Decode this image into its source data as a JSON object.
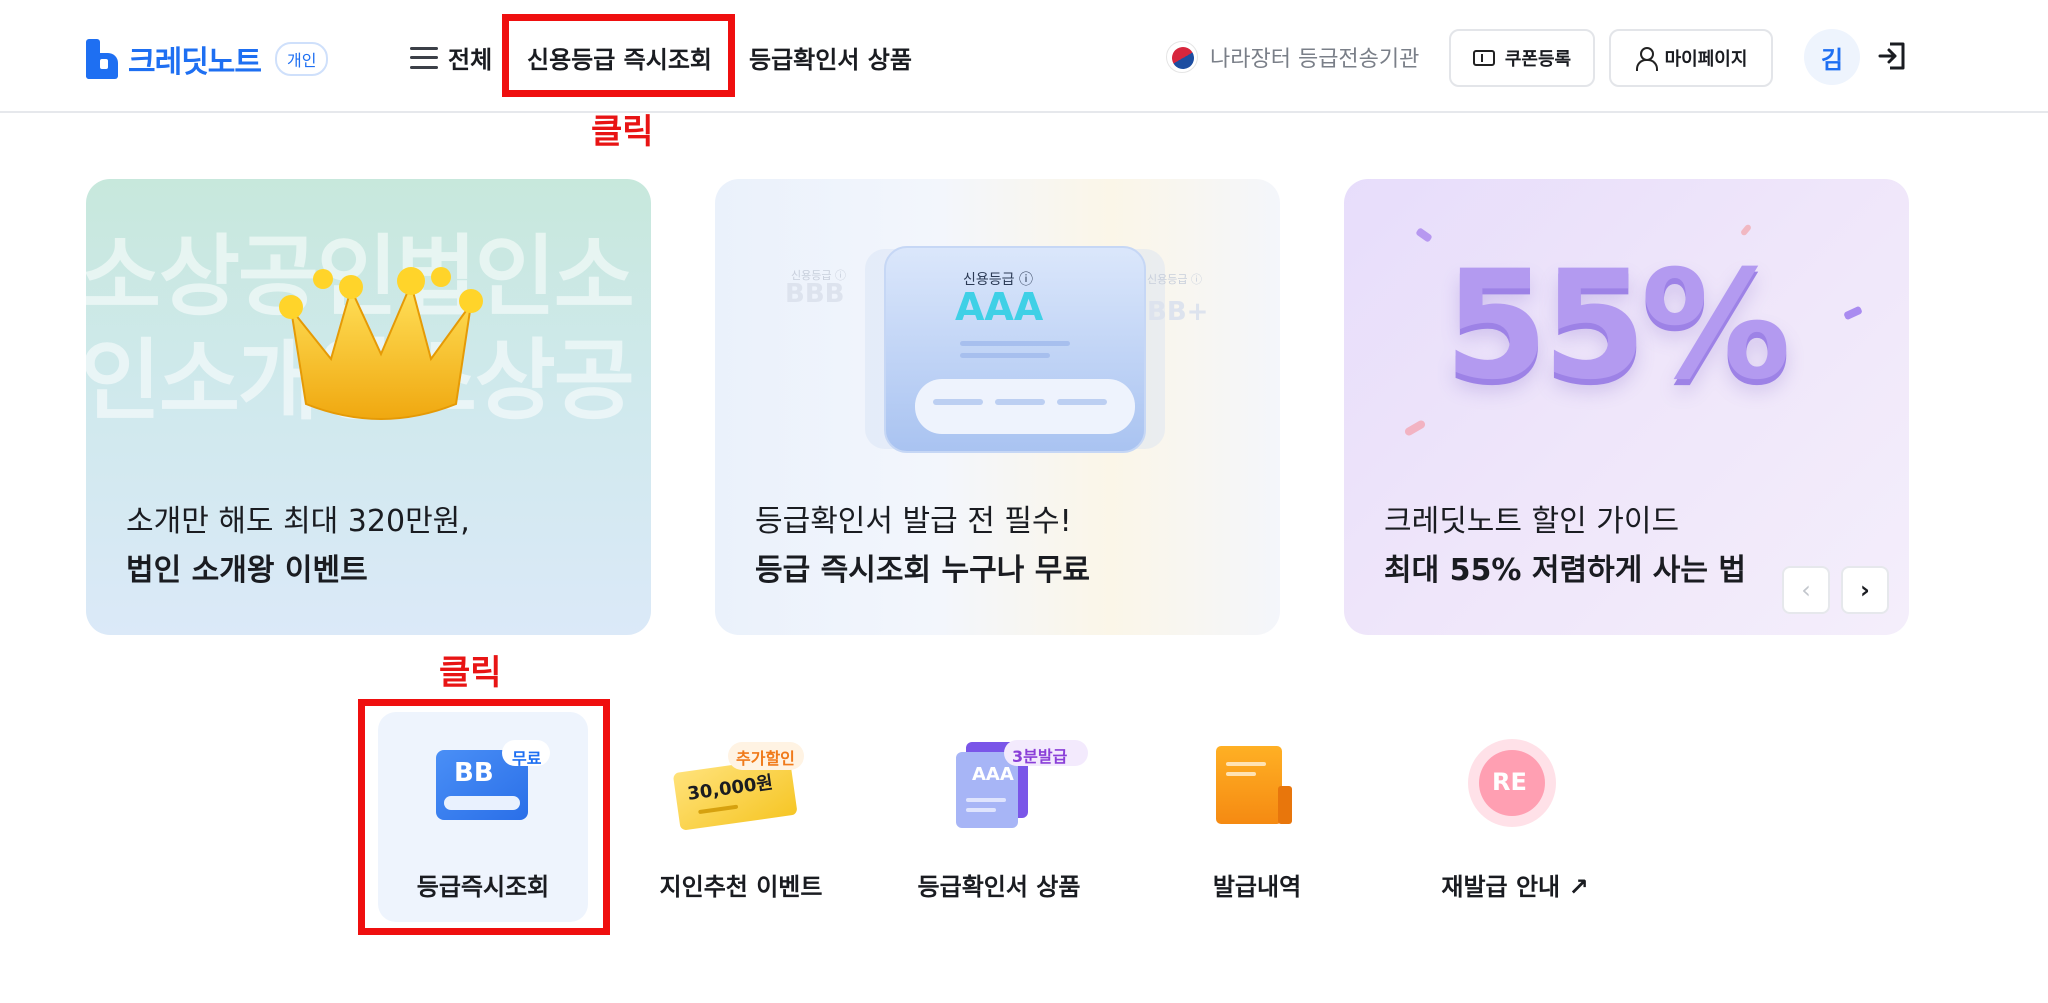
{
  "header": {
    "logo_text": "크레딧노트",
    "logo_badge": "개인",
    "nav_all": "전체",
    "nav_realtime": "신용등급 즉시조회",
    "nav_products": "등급확인서 상품",
    "agency": "나라장터 등급전송기관",
    "coupon": "쿠폰등록",
    "mypage": "마이페이지",
    "avatar": "김"
  },
  "annotations": {
    "click_top": "클릭",
    "click_bottom": "클릭"
  },
  "banners": [
    {
      "line1": "소개만 해도 최대 320만원,",
      "line2": "법인 소개왕 이벤트",
      "bg_row1": "소상공인법인소",
      "bg_row2": "인소개왕소상공"
    },
    {
      "line1": "등급확인서 발급 전 필수!",
      "line2": "등급 즉시조회 누구나 무료",
      "card_label": "신용등급 ⓘ",
      "card_grade": "AAA",
      "ghost_left": "BBB",
      "ghost_right": "BB+",
      "ghost_label": "신용등급 ⓘ"
    },
    {
      "line1": "크레딧노트 할인 가이드",
      "line2": "최대 55% 저렴하게 사는 법",
      "big": "55%"
    }
  ],
  "pager": {
    "prev": "‹",
    "next": "›"
  },
  "quick_menu": [
    {
      "label": "등급즉시조회",
      "tag": "무료",
      "art": "BB"
    },
    {
      "label": "지인추천 이벤트",
      "tag": "추가할인",
      "art": "30,000원"
    },
    {
      "label": "등급확인서 상품",
      "tag": "3분발급",
      "art": "AAA"
    },
    {
      "label": "발급내역"
    },
    {
      "label": "재발급 안내 ↗",
      "art": "RE"
    }
  ],
  "colors": {
    "brand": "#1e6ff2",
    "annotation_red": "#ef0f0f"
  }
}
